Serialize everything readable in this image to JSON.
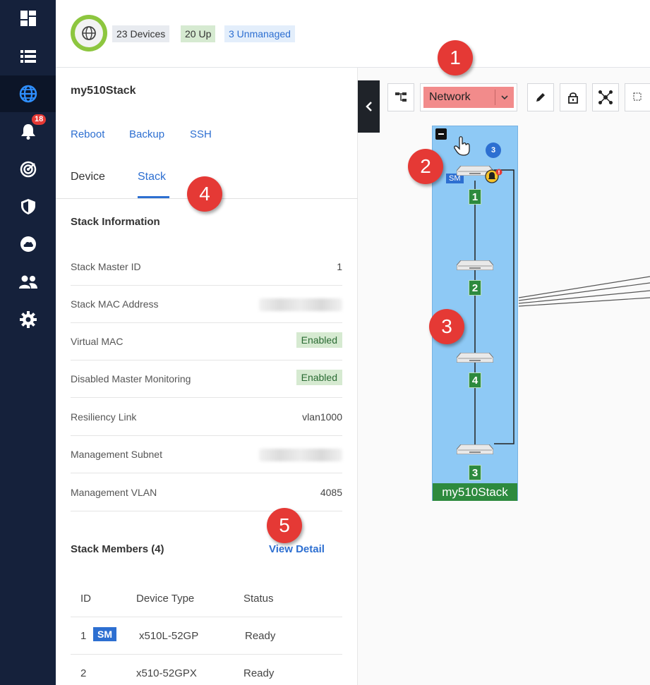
{
  "header": {
    "devices_chip": "23 Devices",
    "up_chip": "20 Up",
    "unmanaged_chip": "3 Unmanaged"
  },
  "nav": {
    "items": [
      {
        "icon": "dashboard-icon"
      },
      {
        "icon": "list-icon"
      },
      {
        "icon": "globe-icon",
        "active": true
      },
      {
        "icon": "bell-icon",
        "badge": "18"
      },
      {
        "icon": "radar-icon"
      },
      {
        "icon": "shield-icon"
      },
      {
        "icon": "cloud-icon"
      },
      {
        "icon": "users-icon"
      },
      {
        "icon": "gear-icon"
      }
    ],
    "alert_badge": "18"
  },
  "panel": {
    "title": "my510Stack",
    "actions": {
      "reboot": "Reboot",
      "backup": "Backup",
      "ssh": "SSH"
    },
    "tabs": {
      "device": "Device",
      "stack": "Stack"
    },
    "section_title": "Stack Information",
    "info": [
      {
        "label": "Stack Master ID",
        "value": "1"
      },
      {
        "label": "Stack MAC Address",
        "value": ""
      },
      {
        "label": "Virtual MAC",
        "value": "Enabled"
      },
      {
        "label": "Disabled Master Monitoring",
        "value": "Enabled"
      },
      {
        "label": "Resiliency Link",
        "value": "vlan1000"
      },
      {
        "label": "Management Subnet",
        "value": ""
      },
      {
        "label": "Management VLAN",
        "value": "4085"
      }
    ],
    "members_title": "Stack Members (4)",
    "view_detail": "View Detail",
    "members_table": {
      "headers": {
        "id": "ID",
        "type": "Device Type",
        "status": "Status"
      },
      "rows": [
        {
          "id": "1",
          "tag": "SM",
          "type": "x510L-52GP",
          "status": "Ready"
        },
        {
          "id": "2",
          "type": "x510-52GPX",
          "status": "Ready"
        }
      ]
    }
  },
  "topology": {
    "view_select": "Network",
    "stack_label": "my510Stack",
    "member_count": "3",
    "sm_chip": "SM",
    "members": [
      "1",
      "2",
      "4",
      "3"
    ]
  },
  "callouts": [
    "1",
    "2",
    "3",
    "4",
    "5"
  ],
  "colors": {
    "rail": "#15213b",
    "accent": "#2d6fd1",
    "up_green": "#8dc63f",
    "stack_fill": "#8ec9f5",
    "member_green": "#2d8a3e",
    "callout_red": "#e53935",
    "select_red": "#f28b8b"
  }
}
